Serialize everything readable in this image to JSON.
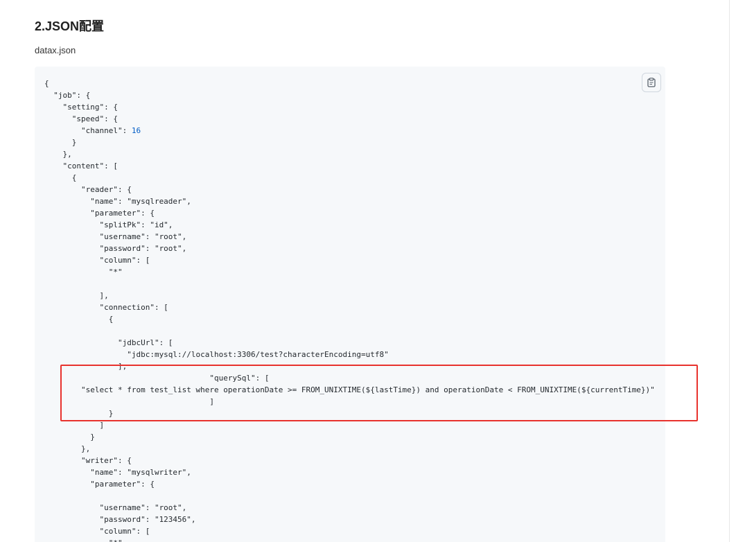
{
  "article": {
    "heading": "2.JSON配置",
    "filename": "datax.json"
  },
  "code": {
    "language": "json",
    "text_color": "#24292e",
    "number_color": "#005cc5",
    "lines": [
      "{",
      "  \"job\": {",
      "    \"setting\": {",
      "      \"speed\": {",
      "        \"channel\": 16",
      "      }",
      "    },",
      "    \"content\": [",
      "      {",
      "        \"reader\": {",
      "          \"name\": \"mysqlreader\",",
      "          \"parameter\": {",
      "            \"splitPk\": \"id\",",
      "            \"username\": \"root\",",
      "            \"password\": \"root\",",
      "            \"column\": [",
      "              \"*\"",
      "",
      "            ],",
      "            \"connection\": [",
      "              {",
      "",
      "                \"jdbcUrl\": [",
      "                  \"jdbc:mysql://localhost:3306/test?characterEncoding=utf8\"",
      "                ],",
      "                                    \"querySql\": [",
      "        \"select * from test_list where operationDate >= FROM_UNIXTIME(${lastTime}) and operationDate < FROM_UNIXTIME(${currentTime})\"",
      "                                    ]",
      "              }",
      "            ]",
      "          }",
      "        },",
      "        \"writer\": {",
      "          \"name\": \"mysqlwriter\",",
      "          \"parameter\": {",
      "",
      "            \"username\": \"root\",",
      "            \"password\": \"123456\",",
      "            \"column\": [",
      "              \"*\""
    ]
  },
  "copy_button": {
    "icon": "clipboard-icon"
  },
  "annotation": {
    "color": "#e8322d"
  }
}
